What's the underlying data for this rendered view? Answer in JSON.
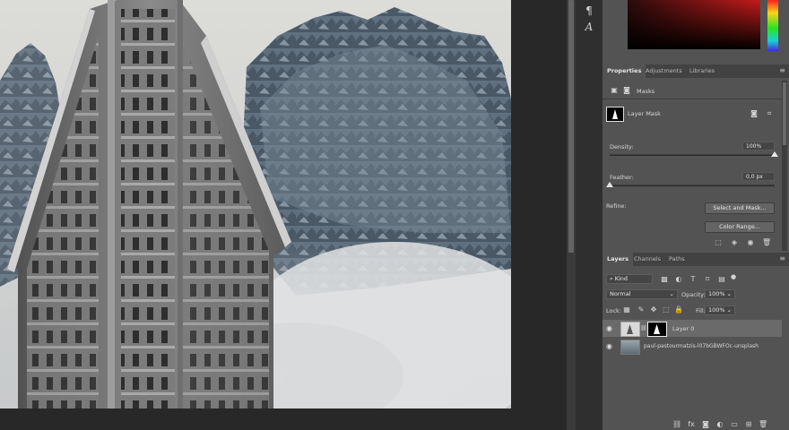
{
  "tools": [
    {
      "icon": "paragraph-icon",
      "glyph": "¶"
    },
    {
      "icon": "character-icon",
      "glyph": "A"
    }
  ],
  "properties": {
    "tabs": [
      {
        "label": "Properties",
        "active": true
      },
      {
        "label": "Adjustments",
        "active": false
      },
      {
        "label": "Libraries",
        "active": false
      }
    ],
    "section_label": "Masks",
    "mask_label": "Layer Mask",
    "density_label": "Density:",
    "density_value": "100%",
    "density_level": 1.0,
    "feather_label": "Feather:",
    "feather_value": "0,0 px",
    "feather_level": 0.0,
    "refine_label": "Refine:",
    "select_mask_button": "Select and Mask...",
    "color_range_button": "Color Range..."
  },
  "layers": {
    "tabs": [
      {
        "label": "Layers",
        "active": true
      },
      {
        "label": "Channels",
        "active": false
      },
      {
        "label": "Paths",
        "active": false
      }
    ],
    "filter_kind": "Kind",
    "blend_mode": "Normal",
    "opacity_label": "Opacity:",
    "opacity_value": "100%",
    "lock_label": "Lock:",
    "fill_label": "Fill:",
    "fill_value": "100%",
    "items": [
      {
        "name": "Layer 0",
        "selected": true,
        "has_mask": true
      },
      {
        "name": "paul-pastourmatzis-l07bGBWFOc-unsplash",
        "selected": false,
        "has_mask": false
      }
    ]
  },
  "colors": {
    "panel_bg": "#535353",
    "app_bg": "#282828",
    "selected_layer": "#6a6a6a"
  }
}
